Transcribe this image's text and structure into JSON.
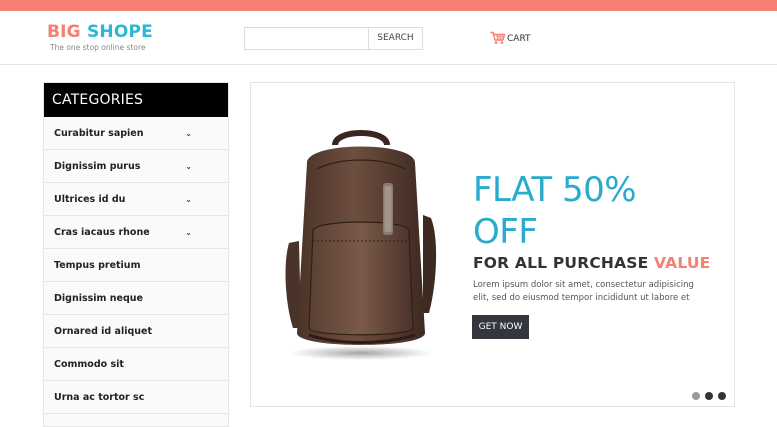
{
  "header": {
    "logo_big": "BIG",
    "logo_shope": "SHOPE",
    "tagline": "The one stop online store",
    "search": {
      "value": "",
      "placeholder": "",
      "button_label": "SEARCH"
    },
    "cart_label": "CART",
    "cart_icon": "cart-icon"
  },
  "sidebar": {
    "heading": "CATEGORIES",
    "items": [
      {
        "label": "Curabitur sapien",
        "has_dropdown": true
      },
      {
        "label": "Dignissim purus",
        "has_dropdown": true
      },
      {
        "label": "Ultrices id du",
        "has_dropdown": true
      },
      {
        "label": "Cras iacaus rhone",
        "has_dropdown": true
      },
      {
        "label": "Tempus pretium",
        "has_dropdown": false
      },
      {
        "label": "Dignissim neque",
        "has_dropdown": false
      },
      {
        "label": "Ornared id aliquet",
        "has_dropdown": false
      },
      {
        "label": "Commodo sit",
        "has_dropdown": false
      },
      {
        "label": "Urna ac tortor sc",
        "has_dropdown": false
      }
    ],
    "chevron": "⌄"
  },
  "banner": {
    "title_line1": "FLAT 50%",
    "title_line2": "OFF",
    "subtitle_main": "FOR ALL PURCHASE",
    "subtitle_accent": "VALUE",
    "description": "Lorem ipsum dolor sit amet, consectetur adipisicing elit, sed do eiusmod tempor incididunt ut labore et",
    "cta_label": "GET NOW",
    "slides": 3,
    "active_slide": 1
  },
  "colors": {
    "accent_coral": "#f47f72",
    "accent_blue": "#29abcc",
    "dark_button": "#33363c"
  }
}
